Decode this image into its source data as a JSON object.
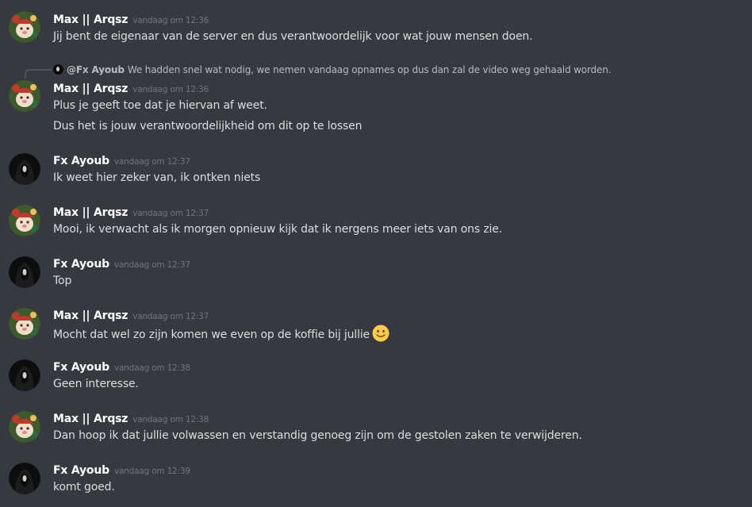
{
  "users": {
    "max": {
      "name": "Max || Arqsz"
    },
    "fx": {
      "name": "Fx Ayoub"
    }
  },
  "messages": [
    {
      "author": "Max || Arqsz",
      "timestamp": "vandaag om 12:36",
      "lines": [
        "Jij bent de eigenaar van de server en dus verantwoordelijk voor wat jouw mensen doen."
      ]
    },
    {
      "author": "Max || Arqsz",
      "timestamp": "vandaag om 12:36",
      "reply": {
        "author": "@Fx Ayoub",
        "text": "We hadden snel wat nodig, we nemen vandaag opnames op dus dan zal de video weg gehaald worden."
      },
      "lines": [
        "Plus je geeft toe dat je hiervan af weet.",
        "Dus het is jouw verantwoordelijkheid om dit op te lossen"
      ]
    },
    {
      "author": "Fx Ayoub",
      "timestamp": "vandaag om 12:37",
      "lines": [
        "Ik weet hier zeker van, ik ontken niets"
      ]
    },
    {
      "author": "Max || Arqsz",
      "timestamp": "vandaag om 12:37",
      "lines": [
        "Mooi, ik verwacht als ik morgen opnieuw kijk dat ik nergens meer iets van ons zie."
      ]
    },
    {
      "author": "Fx Ayoub",
      "timestamp": "vandaag om 12:37",
      "lines": [
        "Top"
      ]
    },
    {
      "author": "Max || Arqsz",
      "timestamp": "vandaag om 12:37",
      "lines": [
        "Mocht dat wel zo zijn komen we even op de koffie bij jullie"
      ],
      "emoji": "slight-smile-emoji"
    },
    {
      "author": "Fx Ayoub",
      "timestamp": "vandaag om 12:38",
      "lines": [
        "Geen interesse."
      ]
    },
    {
      "author": "Max || Arqsz",
      "timestamp": "vandaag om 12:38",
      "lines": [
        "Dan hoop ik dat jullie volwassen en verstandig genoeg zijn om de gestolen zaken te verwijderen."
      ]
    },
    {
      "author": "Fx Ayoub",
      "timestamp": "vandaag om 12:39",
      "lines": [
        "komt goed."
      ]
    }
  ],
  "colors": {
    "background": "#36393f",
    "author": "#ffffff",
    "message_text": "#dcddde",
    "timestamp": "#72767d",
    "reply_text": "#b9bbbe",
    "reply_spine": "#4f545c"
  }
}
